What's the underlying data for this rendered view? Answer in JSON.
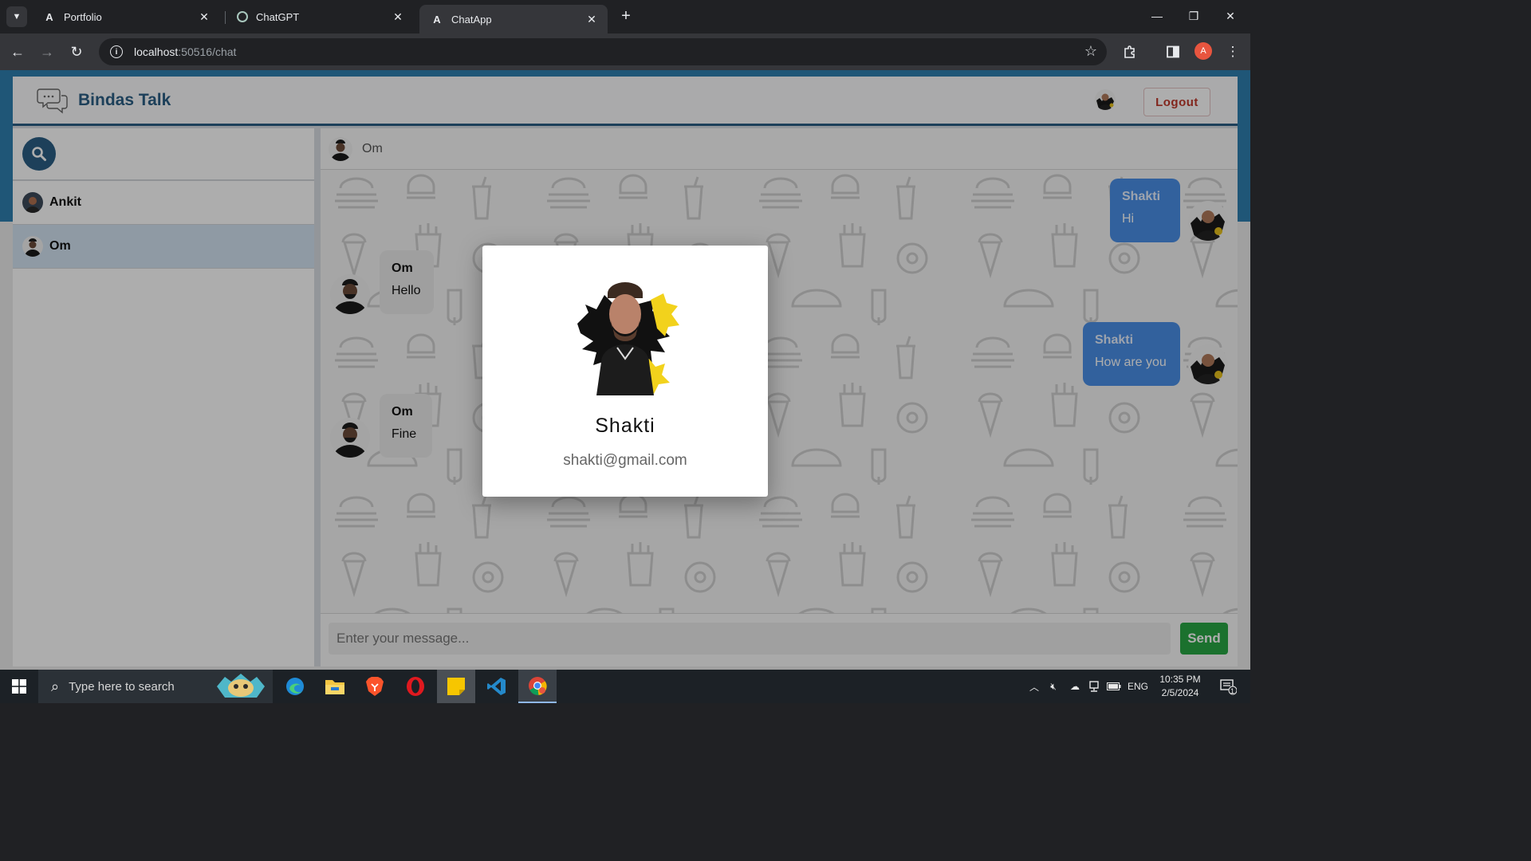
{
  "browser": {
    "tabs": [
      {
        "title": "Portfolio",
        "favicon": "A"
      },
      {
        "title": "ChatGPT",
        "favicon": ""
      },
      {
        "title": "ChatApp",
        "favicon": "A"
      }
    ],
    "url_host": "localhost",
    "url_path": ":50516/chat",
    "profile_initial": "A"
  },
  "app": {
    "brand": "Bindas Talk",
    "logout_label": "Logout",
    "colors": {
      "primary": "#2b5f85",
      "outgoing": "#4a8fe7",
      "send": "#28a745",
      "logout": "#c0392b"
    }
  },
  "sidebar": {
    "users": [
      {
        "name": "Ankit"
      },
      {
        "name": "Om"
      }
    ]
  },
  "chat": {
    "partner_name": "Om",
    "messages": [
      {
        "sender": "Shakti",
        "text": "Hi",
        "direction": "out"
      },
      {
        "sender": "Om",
        "text": "Hello",
        "direction": "in"
      },
      {
        "sender": "Shakti",
        "text": "How are you",
        "direction": "out"
      },
      {
        "sender": "Om",
        "text": "Fine",
        "direction": "in"
      }
    ],
    "input_placeholder": "Enter your message...",
    "send_label": "Send"
  },
  "profile_modal": {
    "name": "Shakti",
    "email": "shakti@gmail.com"
  },
  "taskbar": {
    "search_placeholder": "Type here to search",
    "language": "ENG",
    "time": "10:35 PM",
    "date": "2/5/2024",
    "notification_count": "1"
  }
}
